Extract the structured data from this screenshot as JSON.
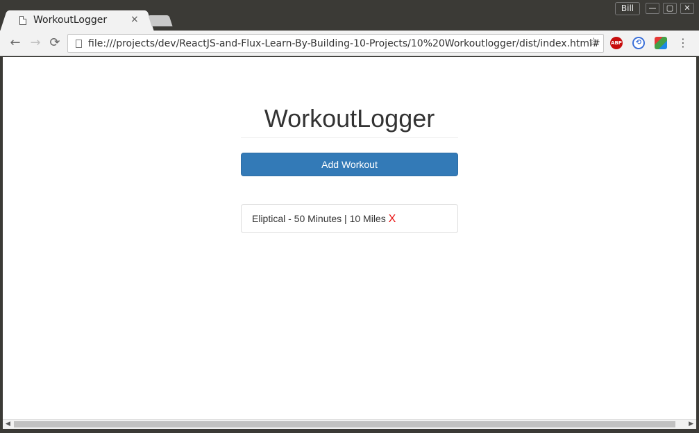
{
  "window": {
    "profile_label": "Bill",
    "minimize_icon": "—",
    "maximize_icon": "▢",
    "close_icon": "✕"
  },
  "tab": {
    "title": "WorkoutLogger",
    "close_glyph": "×"
  },
  "toolbar": {
    "back_glyph": "←",
    "forward_glyph": "→",
    "reload_glyph": "⟳",
    "url": "file:///projects/dev/ReactJS-and-Flux-Learn-By-Building-10-Projects/10%20Workoutlogger/dist/index.html#",
    "bookmark_glyph": "☆",
    "extensions": {
      "abp_label": "ABP",
      "sync_glyph": "⟲"
    },
    "menu_glyph": "⋮"
  },
  "app": {
    "title": "WorkoutLogger",
    "add_button_label": "Add Workout",
    "workouts": [
      {
        "text": "Eliptical - 50 Minutes | 10 Miles",
        "delete_label": "X"
      }
    ]
  },
  "colors": {
    "primary_button": "#337ab7",
    "delete_red": "#e81010"
  }
}
